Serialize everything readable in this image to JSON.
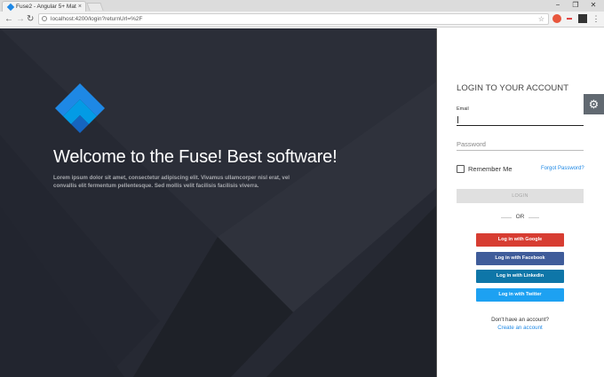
{
  "browser": {
    "tab_title": "Fuse2 - Angular 5+ Mat",
    "tab_close": "×",
    "url": "localhost:4200/login?returnUrl=%2F",
    "back": "←",
    "forward": "→",
    "reload": "↻",
    "star": "☆",
    "minimize": "−",
    "maximize": "❐",
    "close": "✕",
    "menu": "⋮"
  },
  "left": {
    "welcome": "Welcome to the Fuse! Best software!",
    "description": "Lorem ipsum dolor sit amet, consectetur adipiscing elit. Vivamus ullamcorper nisl erat, vel convallis elit fermentum pellentesque. Sed mollis velit facilisis facilisis viverra."
  },
  "login": {
    "title": "LOGIN TO YOUR ACCOUNT",
    "email_label": "Email",
    "email_value": "",
    "password_placeholder": "Password",
    "remember_me": "Remember Me",
    "forgot_password": "Forgot Password?",
    "login_button": "LOGIN",
    "or": "OR",
    "google": "Log in with Google",
    "facebook": "Log in with Facebook",
    "linkedin": "Log in with Linkedin",
    "twitter": "Log in with Twitter",
    "no_account": "Don't have an account?",
    "create_account": "Create an account"
  },
  "colors": {
    "accent": "#1e88e5",
    "left_bg": "#262933",
    "google": "#d73d32",
    "facebook": "#3f5c9a",
    "linkedin": "#0e76a8",
    "twitter": "#1da1f2"
  }
}
